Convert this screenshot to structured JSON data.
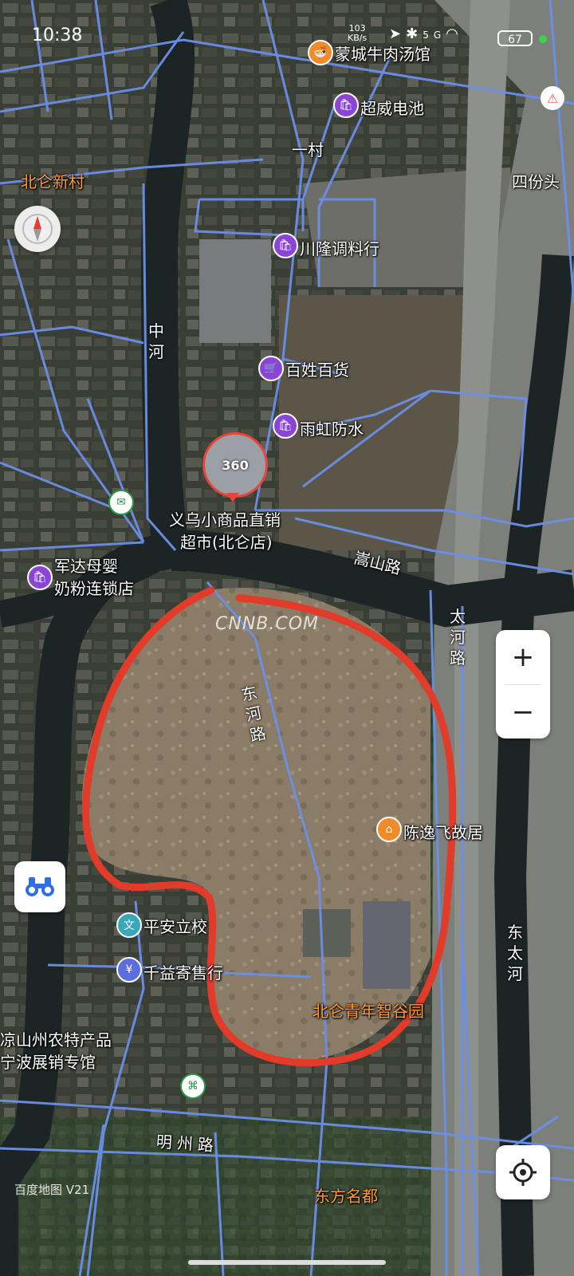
{
  "status_bar": {
    "time": "10:38",
    "net_speed": "103",
    "net_unit": "KB/s",
    "network": "5G",
    "battery": "67"
  },
  "map": {
    "watermark": "CNNB.COM",
    "logo": "百度地图 V21",
    "roads": {
      "zhonghe": "中河",
      "songshan": "嵩山路",
      "donghe": "东河路",
      "taihe": "太河路",
      "dongtaihe": "东太河",
      "mingzhou": "明州路"
    },
    "places": {
      "yicun": "一村",
      "beilun_xincun": "北仑新村",
      "sifentou": "四份头",
      "dongfang_mingdu": "东方名都",
      "yiwu_line1": "义乌小商品直销",
      "yiwu_line2": "超市(北仑店)",
      "youth_park": "北仑青年智谷园"
    },
    "pois": [
      {
        "label": "蒙城牛肉汤馆",
        "icon": "restaurant-icon"
      },
      {
        "label": "超威电池",
        "icon": "shopping-bag-icon"
      },
      {
        "label": "川隆调料行",
        "icon": "shopping-bag-icon"
      },
      {
        "label": "百姓百货",
        "icon": "cart-icon"
      },
      {
        "label": "雨虹防水",
        "icon": "shopping-bag-icon"
      },
      {
        "label": "军达母婴",
        "label2": "奶粉连锁店",
        "icon": "shopping-bag-icon"
      },
      {
        "label": "陈逸飞故居",
        "icon": "historic-house-icon"
      },
      {
        "label": "平安立校",
        "icon": "school-icon"
      },
      {
        "label": "千益寄售行",
        "icon": "yen-icon"
      },
      {
        "label": "凉山州农特产品",
        "label2": "宁波展销专馆",
        "icon": "store-icon"
      }
    ],
    "streetview_badge": "360"
  },
  "controls": {
    "zoom_in": "+",
    "zoom_out": "−"
  }
}
